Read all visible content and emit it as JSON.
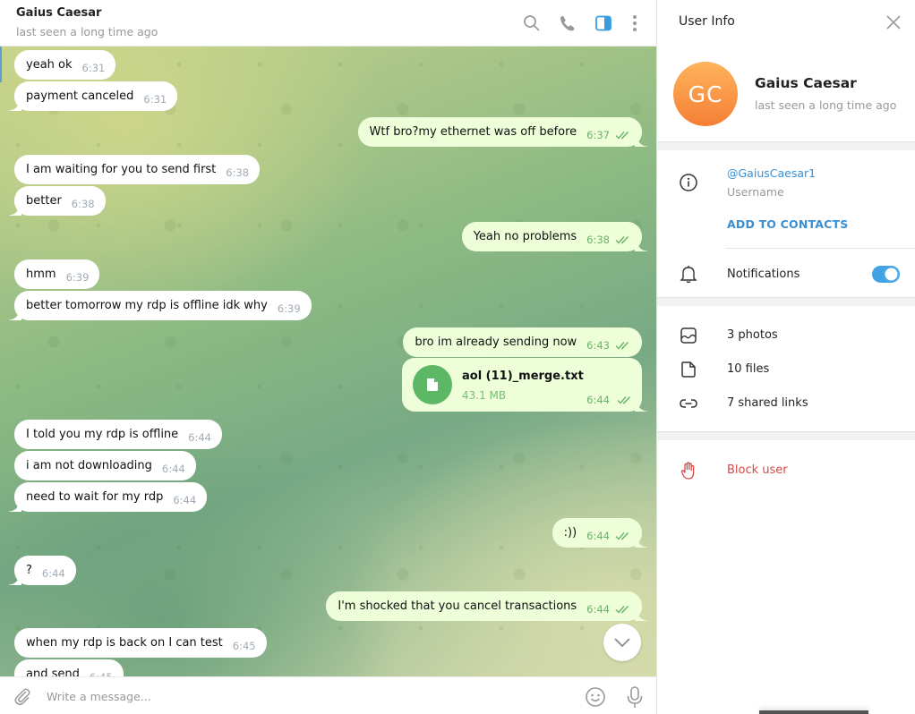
{
  "chat": {
    "header": {
      "title": "Gaius Caesar",
      "status": "last seen a long time ago",
      "icons": [
        "search-icon",
        "phone-icon",
        "sidebar-toggle-icon",
        "more-vertical-icon"
      ]
    },
    "messages": [
      {
        "dir": "in",
        "text": "yeah ok",
        "time": "6:31"
      },
      {
        "dir": "in",
        "text": "payment canceled",
        "time": "6:31"
      },
      {
        "dir": "out",
        "text": "Wtf bro?my ethernet was off before",
        "time": "6:37",
        "read": true
      },
      {
        "dir": "in",
        "text": "I am waiting for you to send first",
        "time": "6:38"
      },
      {
        "dir": "in",
        "text": "better",
        "time": "6:38"
      },
      {
        "dir": "out",
        "text": "Yeah no problems",
        "time": "6:38",
        "read": true
      },
      {
        "dir": "in",
        "text": "hmm",
        "time": "6:39"
      },
      {
        "dir": "in",
        "text": "better tomorrow my rdp is offline idk why",
        "time": "6:39"
      },
      {
        "dir": "out",
        "text": "bro im already sending now",
        "time": "6:43",
        "read": true
      },
      {
        "dir": "in",
        "text": "I told you my rdp is offline",
        "time": "6:44"
      },
      {
        "dir": "in",
        "text": "i am not downloading",
        "time": "6:44"
      },
      {
        "dir": "in",
        "text": "need to wait for my rdp",
        "time": "6:44"
      },
      {
        "dir": "out",
        "text": ":))",
        "time": "6:44",
        "read": true
      },
      {
        "dir": "in",
        "text": "?",
        "time": "6:44"
      },
      {
        "dir": "out",
        "text": "I'm shocked that you cancel transactions",
        "time": "6:44",
        "read": true
      },
      {
        "dir": "in",
        "text": "when my rdp is back on I can test",
        "time": "6:45"
      },
      {
        "dir": "in",
        "text": "and send",
        "time": "6:45"
      }
    ],
    "file_message": {
      "name": "aol (11)_merge.txt",
      "size": "43.1 MB",
      "time": "6:44",
      "read": true
    },
    "composer": {
      "placeholder": "Write a message..."
    }
  },
  "info_panel": {
    "title": "User Info",
    "avatar_initials": "GC",
    "name": "Gaius Caesar",
    "status": "last seen a long time ago",
    "username": "@GaiusCaesar1",
    "username_label": "Username",
    "add_to_contacts": "ADD TO CONTACTS",
    "notifications_label": "Notifications",
    "notifications_enabled": true,
    "media": {
      "photos": "3 photos",
      "files": "10 files",
      "links": "7 shared links"
    },
    "block_user": "Block user"
  },
  "colors": {
    "accent": "#3a8fd3",
    "toggle": "#41a3e3",
    "outgoing_bubble": "#eefed9",
    "outgoing_time": "#6cb26a",
    "file_icon": "#5db866",
    "danger": "#d44a4a",
    "avatar_top": "#ffb35c",
    "avatar_bottom": "#f57f35"
  }
}
